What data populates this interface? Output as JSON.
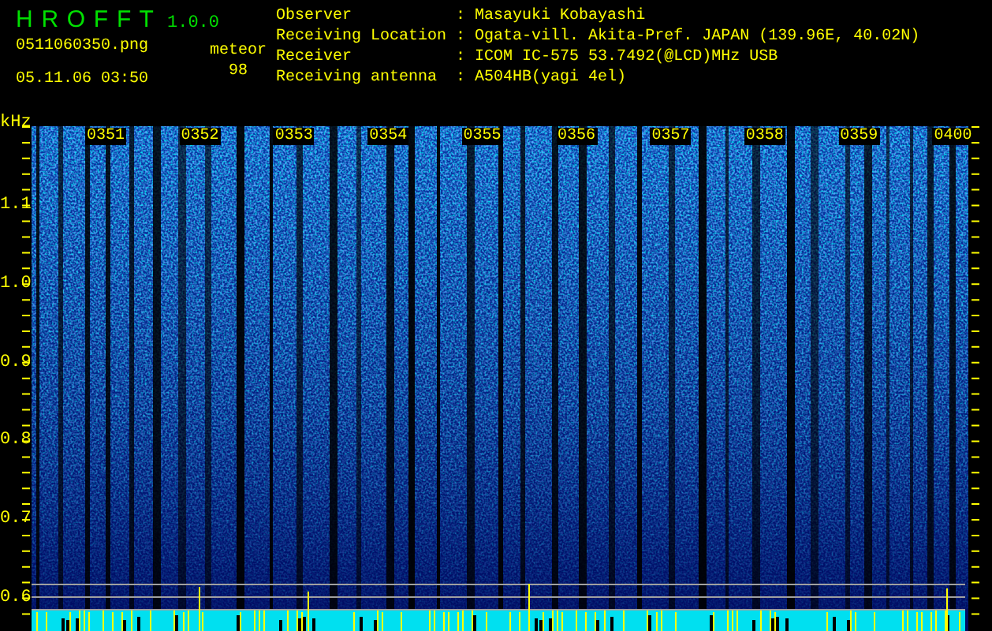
{
  "header": {
    "app_title": "H R O F F T",
    "version": "1.0.0",
    "filename": "0511060350.png",
    "datetime": "05.11.06 03:50",
    "meteor_label": "meteor",
    "meteor_count": "98"
  },
  "station": [
    {
      "label": "Observer",
      "separator": ":",
      "value": "Masayuki Kobayashi"
    },
    {
      "label": "Receiving Location",
      "separator": ":",
      "value": "Ogata-vill. Akita-Pref. JAPAN (139.96E, 40.02N)"
    },
    {
      "label": "Receiver",
      "separator": ":",
      "value": "ICOM IC-575 53.7492(@LCD)MHz USB"
    },
    {
      "label": "Receiving antenna",
      "separator": ":",
      "value": "A504HB(yagi 4el)"
    }
  ],
  "frequency_axis": {
    "unit": "kHz",
    "ticks": [
      "1.1",
      "1.0",
      "0.9",
      "0.8",
      "0.7",
      "0.6"
    ]
  },
  "time_axis": {
    "ticks": [
      "0351",
      "0352",
      "0353",
      "0354",
      "0355",
      "0356",
      "0357",
      "0358",
      "0359",
      "0400"
    ]
  }
}
